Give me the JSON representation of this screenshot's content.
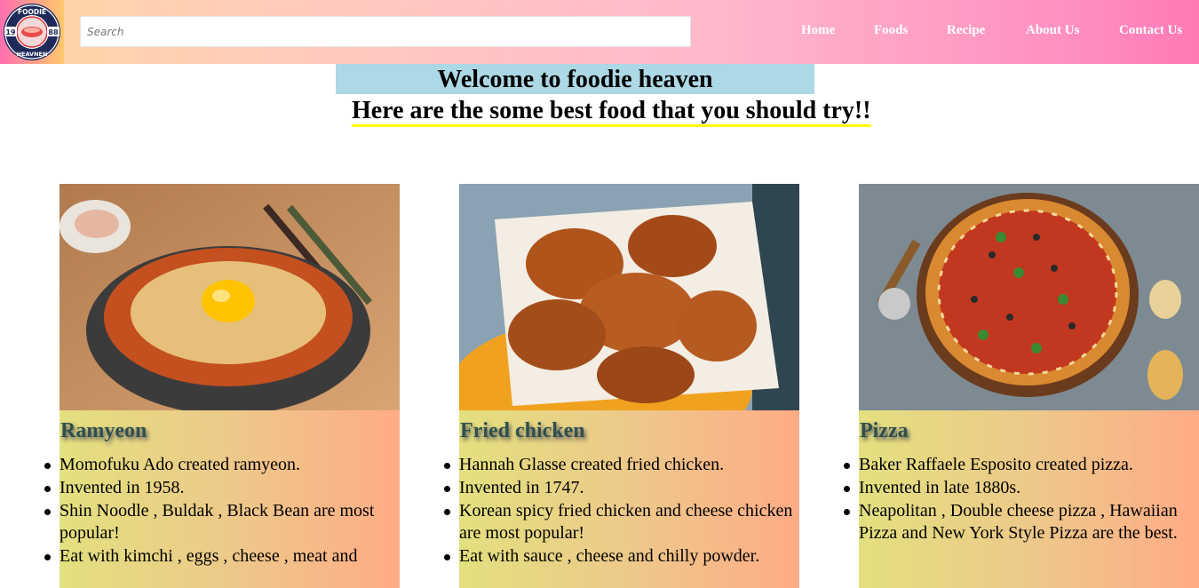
{
  "header": {
    "logo": {
      "top_text": "FOODIE",
      "bottom_text": "HEAVNEN",
      "left_num": "19",
      "right_num": "88"
    },
    "search_placeholder": "Search",
    "nav": [
      "Home",
      "Foods",
      "Recipe",
      "About Us",
      "Contact Us"
    ]
  },
  "main": {
    "welcome": "Welcome to foodie heaven",
    "subtitle": "Here are the some best food that you should try!!"
  },
  "cards": [
    {
      "title": "Ramyeon",
      "items": [
        "Momofuku Ado created ramyeon.",
        "Invented in 1958.",
        "Shin Noodle , Buldak , Black Bean are most popular!",
        "Eat with kimchi , eggs , cheese , meat and"
      ]
    },
    {
      "title": "Fried chicken",
      "items": [
        "Hannah Glasse created fried chicken.",
        "Invented in 1747.",
        "Korean spicy fried chicken and cheese chicken are most popular!",
        "Eat with sauce , cheese and chilly powder."
      ]
    },
    {
      "title": "Pizza",
      "items": [
        "Baker Raffaele Esposito created pizza.",
        "Invented in late 1880s.",
        "Neapolitan , Double cheese pizza , Hawaiian Pizza and New York Style Pizza are the best."
      ]
    }
  ],
  "colors": {
    "nav_gradient_start": "#ffd6a5",
    "nav_gradient_end": "#ff79b5",
    "welcome_bg": "#add8e6",
    "subtitle_underline": "#ffff00",
    "card_gradient_start": "#e3e07f",
    "card_gradient_end": "#ffab86",
    "card_title": "#2f4f4f"
  }
}
